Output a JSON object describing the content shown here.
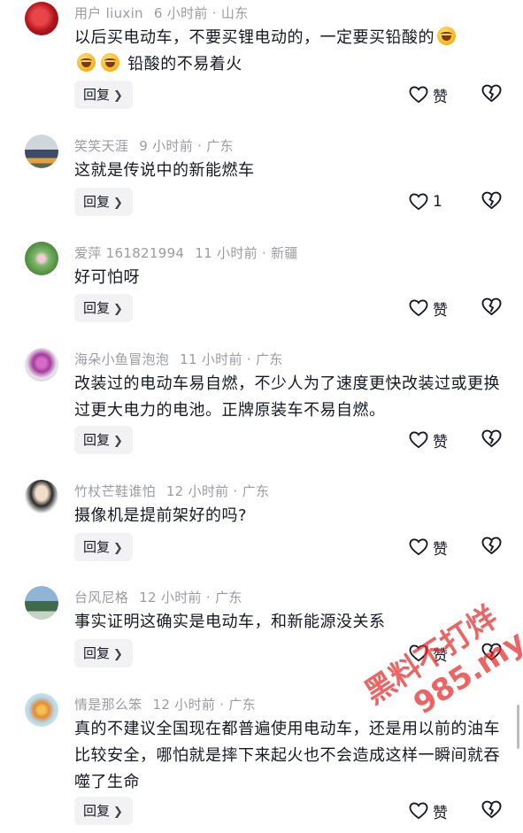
{
  "comments": [
    {
      "user": "用户 liuxin",
      "time": "6 小时前 · 山东",
      "text_parts": [
        "以后买电动车，不要买锂电动的，一定要买铅酸的",
        "铅酸的不易着火"
      ],
      "emoji": "laughing-emoji",
      "reply": "回复",
      "likes": "赞"
    },
    {
      "user": "笑笑天涯",
      "time": "9 小时前 · 广东",
      "text": "这就是传说中的新能燃车",
      "reply": "回复",
      "likes": "1"
    },
    {
      "user": "爱萍 161821994",
      "time": "11 小时前 · 新疆",
      "text": "好可怕呀",
      "reply": "回复",
      "likes": "赞"
    },
    {
      "user": "海朵小鱼冒泡泡",
      "time": "11 小时前 · 广东",
      "text": "改装过的电动车易自燃，不少人为了速度更快改装过或更换过更大电力的电池。正牌原装车不易自燃。",
      "reply": "回复",
      "likes": "赞"
    },
    {
      "user": "竹杖芒鞋谁怕",
      "time": "12 小时前 · 广东",
      "text": "摄像机是提前架好的吗?",
      "reply": "回复",
      "likes": "赞"
    },
    {
      "user": "台风尼格",
      "time": "12 小时前 · 广东",
      "text": "事实证明这确实是电动车，和新能源没关系",
      "reply": "回复",
      "likes": "赞"
    },
    {
      "user": "情是那么笨",
      "time": "12 小时前 · 广东",
      "text": "真的不建议全国现在都普遍使用电动车，还是用以前的油车比较安全，哪怕就是摔下来起火也不会造成这样一瞬间就吞噬了生命",
      "reply": "回复",
      "likes": "赞"
    }
  ],
  "watermark": {
    "line1": "黑料不打烊",
    "line2": "985.my"
  },
  "colors": {
    "meta": "#9b9ca3",
    "text": "#161823",
    "reply_bg": "#f2f2f4",
    "watermark": "#e42828"
  }
}
